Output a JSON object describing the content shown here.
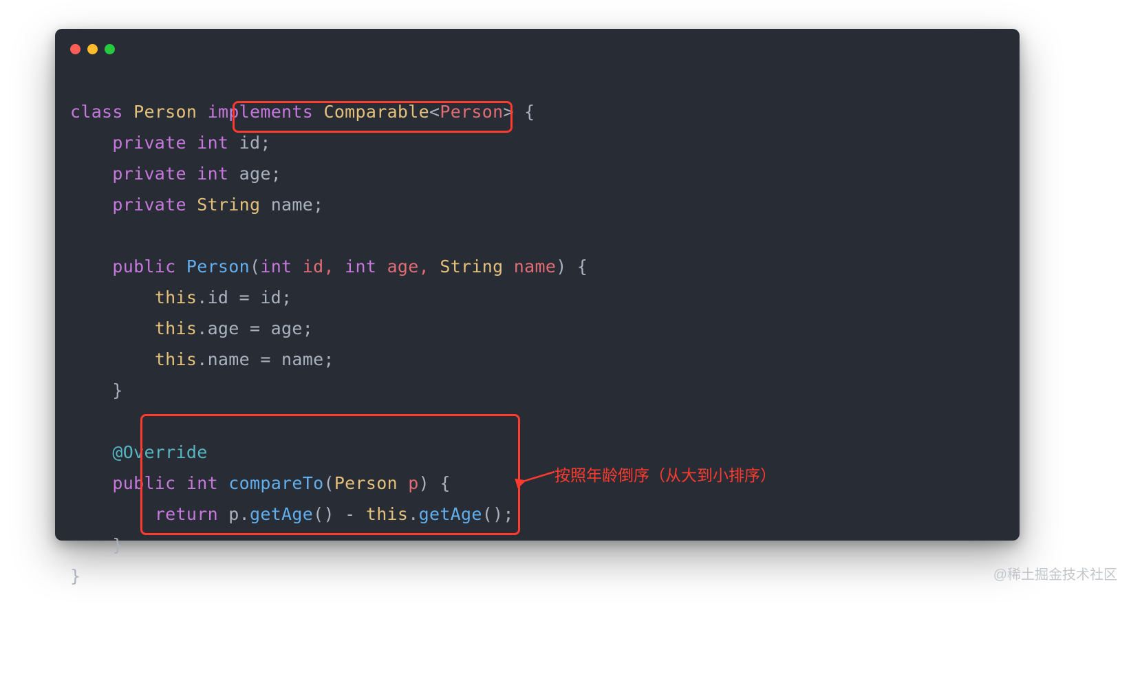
{
  "annotation": {
    "text": "按照年龄倒序（从大到小排序）"
  },
  "watermark": "@稀土掘金技术社区",
  "code": {
    "kw_class": "class",
    "class_name": "Person",
    "kw_implements": "implements",
    "iface": "Comparable",
    "gen_open": "<",
    "gen_type": "Person",
    "gen_close": ">",
    "brace_open": " {",
    "kw_private": "private",
    "type_int": "int",
    "type_string": "String",
    "field_id": " id;",
    "field_age": " age;",
    "field_name": " name;",
    "kw_public": "public",
    "ctor_name": "Person",
    "ctor_p_id": "int",
    "ctor_p_id_name": " id, ",
    "ctor_p_age": "int",
    "ctor_p_age_name": " age, ",
    "ctor_p_name_t": "String",
    "ctor_p_name_name": " name",
    "ctor_paren": "(",
    "ctor_close_paren": ")",
    "ctor_brace": " {",
    "this": "this",
    "assign_id": ".id = id;",
    "assign_age": ".age = age;",
    "assign_name": ".name = name;",
    "brace_close": "}",
    "ann_override": "@Override",
    "cmp_name": "compareTo",
    "cmp_param_t": "Person",
    "cmp_param_n": " p",
    "kw_return": "return",
    "cmp_body_a": " p.",
    "cmp_body_getage1": "getAge",
    "cmp_body_b": "() - ",
    "cmp_body_c": ".",
    "cmp_body_getage2": "getAge",
    "cmp_body_d": "();"
  }
}
